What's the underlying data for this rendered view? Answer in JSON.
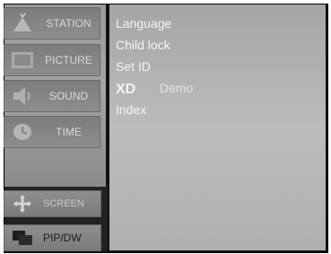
{
  "side_menu": {
    "items": [
      {
        "label": "STATION",
        "icon": "station-icon"
      },
      {
        "label": "PICTURE",
        "icon": "picture-icon"
      },
      {
        "label": "SOUND",
        "icon": "sound-icon"
      },
      {
        "label": "TIME",
        "icon": "time-icon"
      }
    ],
    "bottom": [
      {
        "label": "SCREEN",
        "icon": "screen-icon"
      },
      {
        "label": "PIP/DW",
        "icon": "pip-icon"
      }
    ]
  },
  "submenu": {
    "items": [
      "Language",
      "Child lock",
      "Set ID",
      "Demo",
      "Index"
    ],
    "xd_logo": "XD"
  }
}
